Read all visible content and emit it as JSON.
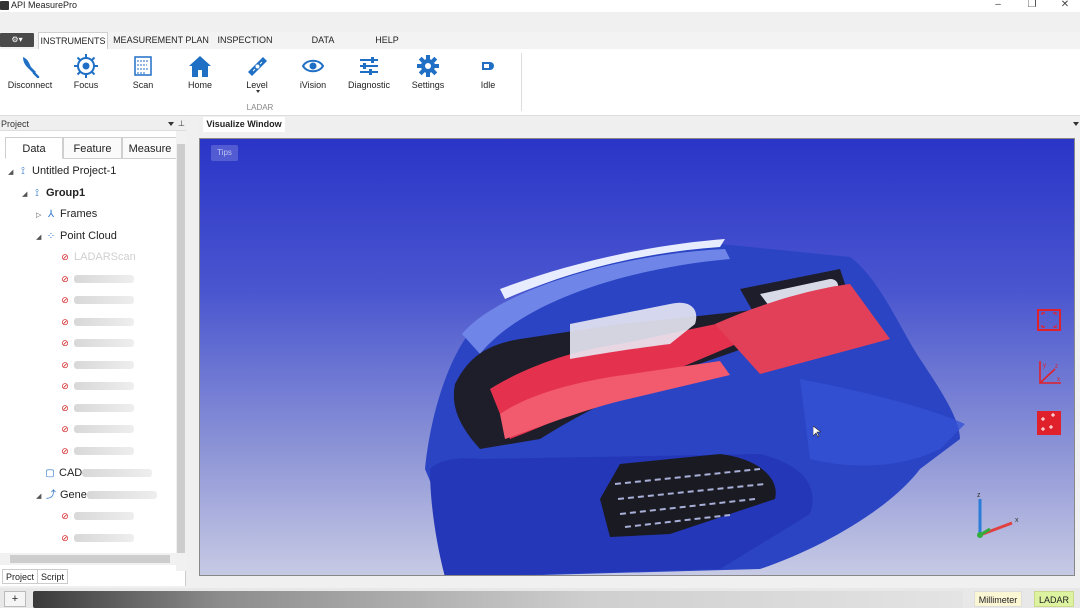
{
  "app": {
    "title": "API MeasurePro",
    "window_controls": {
      "minimize": "–",
      "maximize": "❐",
      "close": "✕"
    },
    "quick_access": "⚙▾"
  },
  "ribbon": {
    "tabs": [
      "INSTRUMENTS",
      "MEASUREMENT PLAN",
      "INSPECTION",
      "DATA PROCESSING",
      "HELP"
    ],
    "active_tab": "INSTRUMENTS",
    "buttons": [
      {
        "label": "Disconnect",
        "icon": "disconnect-icon"
      },
      {
        "label": "Focus",
        "icon": "focus-icon"
      },
      {
        "label": "Scan",
        "icon": "scan-icon"
      },
      {
        "label": "Home",
        "icon": "home-icon"
      },
      {
        "label": "Level",
        "icon": "level-icon"
      },
      {
        "label": "iVision",
        "icon": "eye-icon"
      },
      {
        "label": "Diagnostic",
        "icon": "sliders-icon"
      },
      {
        "label": "Settings",
        "icon": "gear-icon"
      },
      {
        "label": "Idle",
        "icon": "idle-icon"
      }
    ],
    "group_label": "LADAR",
    "accent_color": "#1f6fc5"
  },
  "project_panel": {
    "title": "Project",
    "tabs": [
      "Data",
      "Feature",
      "Measure"
    ],
    "active_tab": "Data",
    "bottom_tabs": [
      "Project",
      "Script"
    ],
    "tree": {
      "project": "Untitled Project-1",
      "group": "Group1",
      "frames": "Frames",
      "point_cloud": "Point Cloud",
      "ladar_scan": "LADARScan",
      "cad": "CAD",
      "generic": "Gene"
    }
  },
  "visualize": {
    "tab": "Visualize Window",
    "tips": "Tips",
    "side_icons": [
      "fit-view-icon",
      "axis-view-icon",
      "point-select-icon"
    ],
    "axis_labels": {
      "x": "x",
      "y": "y",
      "z": "z"
    }
  },
  "status": {
    "add": "+",
    "unit": "Millimeter",
    "mode": "LADAR"
  }
}
